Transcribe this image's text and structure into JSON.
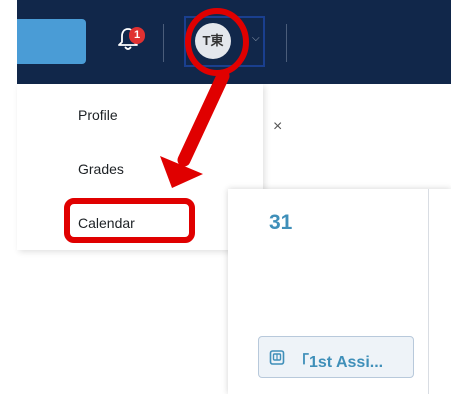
{
  "navbar": {
    "notification_count": "1",
    "avatar_initials": "T東",
    "icons": {
      "bell": "bell-icon",
      "caret": "chevron-down-icon"
    }
  },
  "user_menu": {
    "items": [
      {
        "label": "Profile"
      },
      {
        "label": "Grades"
      },
      {
        "label": "Calendar"
      }
    ]
  },
  "drawer": {
    "close_symbol": "×"
  },
  "calendar": {
    "day": "31",
    "event_title": "「1st Assi...",
    "event_icon": "assignment-icon"
  },
  "colors": {
    "navbar": "#11274a",
    "accent_blue": "#4a9cd6",
    "badge": "#e03131",
    "highlight": "#e00000",
    "link": "#3f8fb9"
  }
}
